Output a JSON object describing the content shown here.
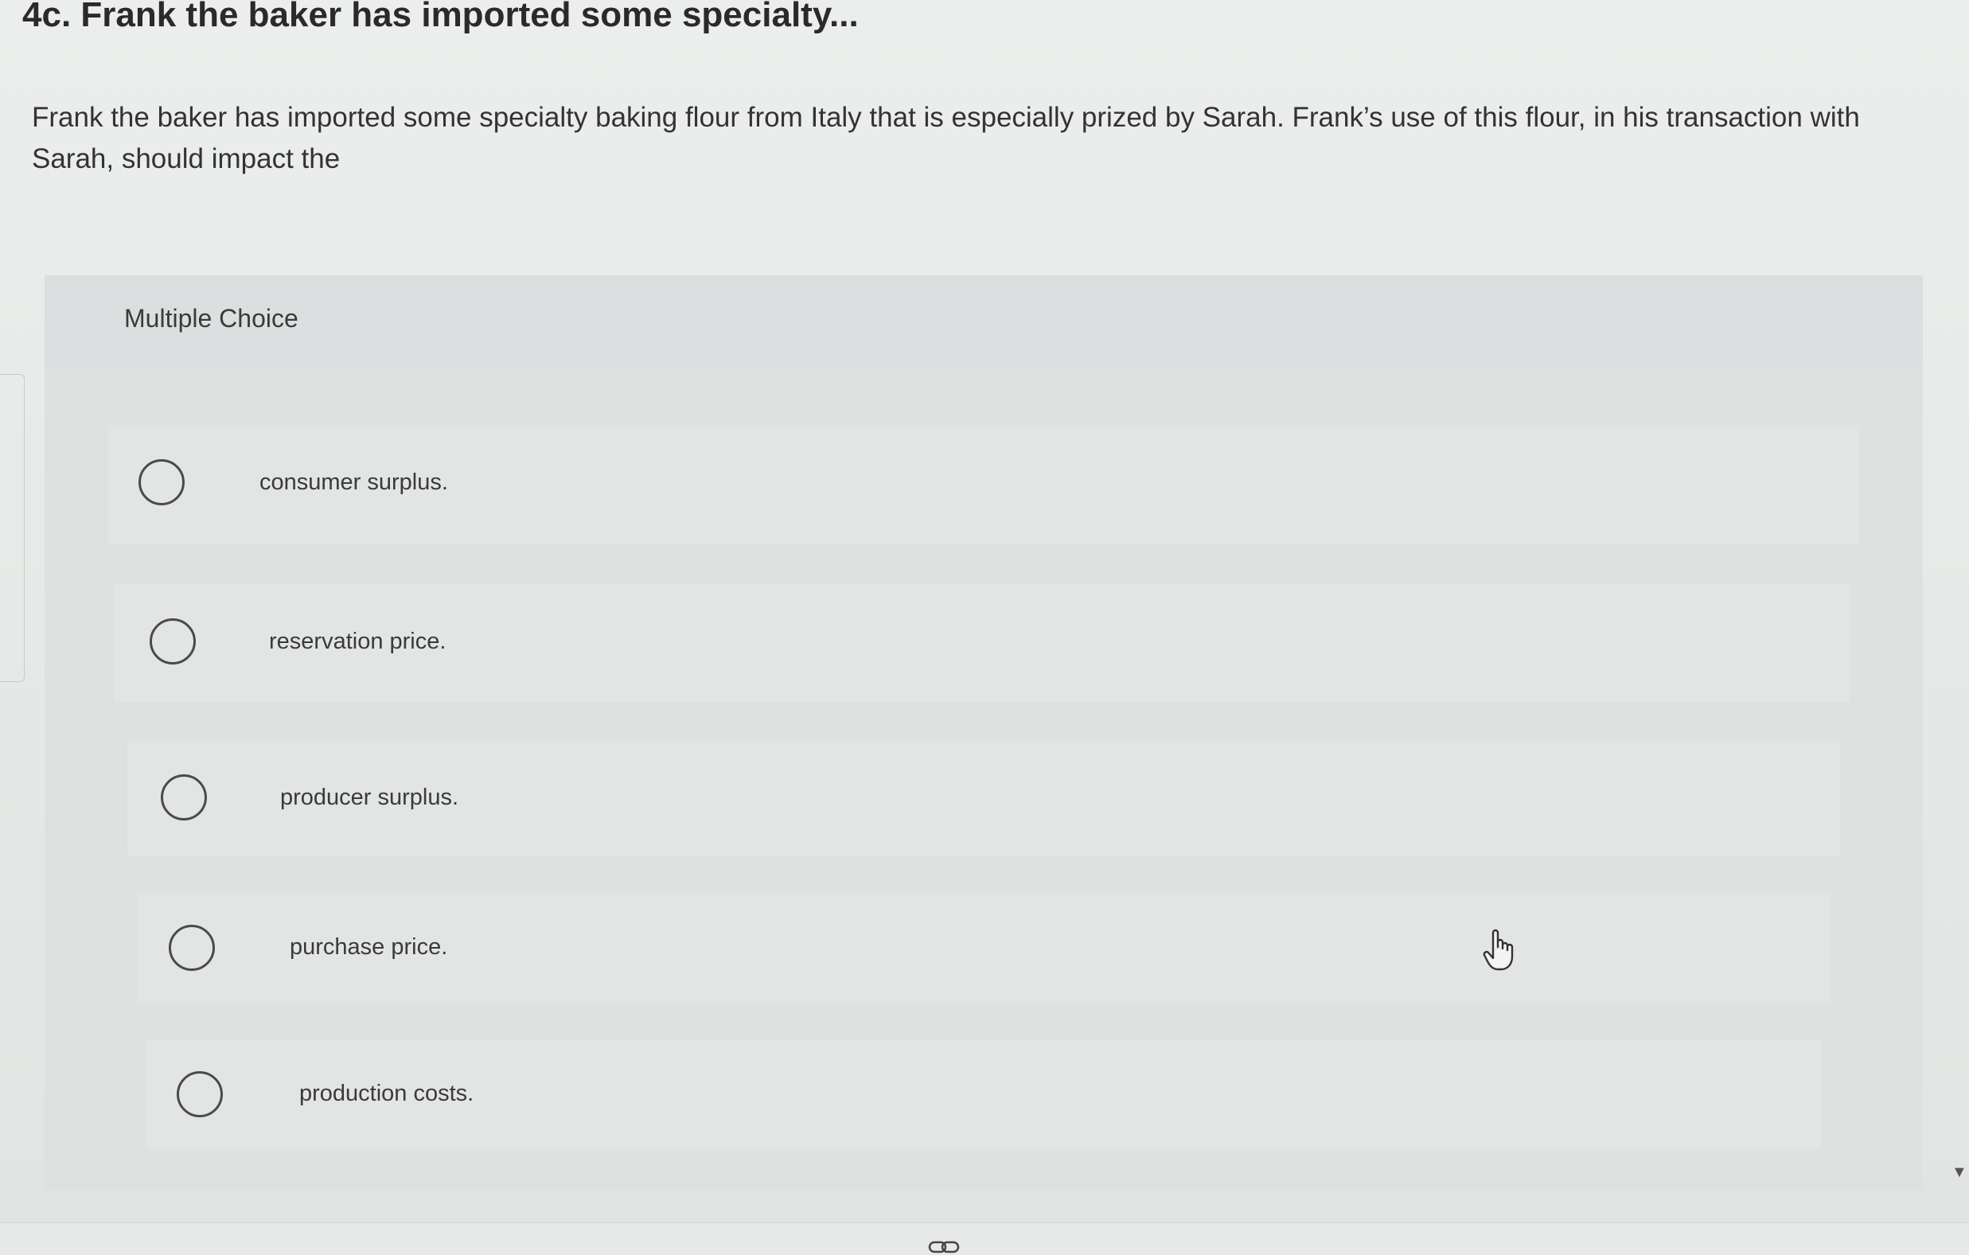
{
  "question": {
    "title": "4c. Frank the baker has imported some specialty...",
    "text": "Frank the baker has imported some specialty baking flour from Italy that is especially prized by Sarah. Frank’s use of this flour, in his transaction with Sarah, should impact the"
  },
  "multiple_choice": {
    "label": "Multiple Choice",
    "options": [
      {
        "label": "consumer surplus.",
        "selected": false
      },
      {
        "label": "reservation price.",
        "selected": false
      },
      {
        "label": "producer surplus.",
        "selected": false
      },
      {
        "label": "purchase price.",
        "selected": false
      },
      {
        "label": "production costs.",
        "selected": false
      }
    ]
  },
  "icons": {
    "radio": "radio-circle-icon",
    "cursor": "hand-pointer-icon",
    "link": "link-icon"
  }
}
